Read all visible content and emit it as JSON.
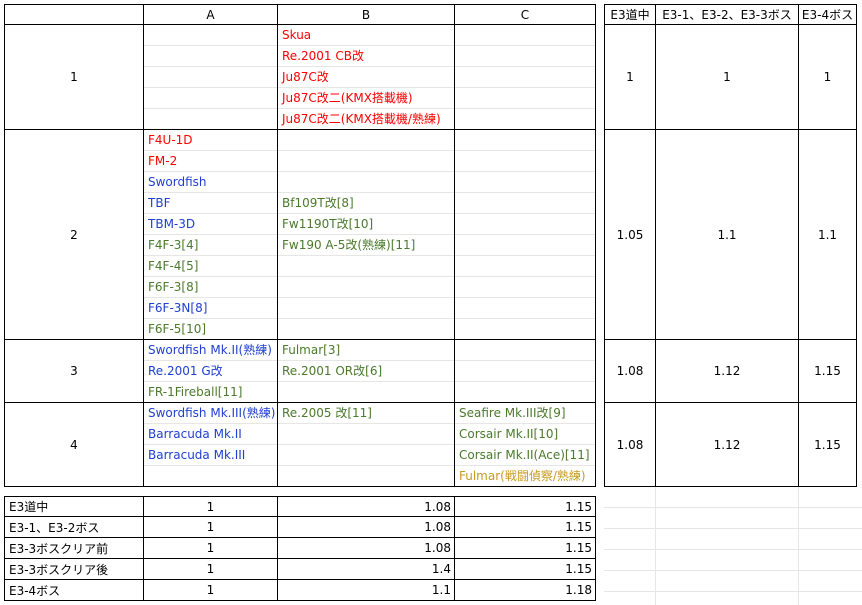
{
  "headers": {
    "corner": "",
    "col_a": "A",
    "col_b": "B",
    "col_c": "C",
    "r1": "E3道中",
    "r2": "E3-1、E3-2、E3-3ボス",
    "r3": "E3-4ボス"
  },
  "colors": {
    "red": "#ff0000",
    "blue": "#1f3fd0",
    "green": "#4a7a2b",
    "orange": "#c89a1e"
  },
  "groups": [
    {
      "label": "1",
      "a": [],
      "b": [
        {
          "text": "Skua",
          "color": "red"
        },
        {
          "text": "Re.2001 CB改",
          "color": "red"
        },
        {
          "text": "Ju87C改",
          "color": "red"
        },
        {
          "text": "Ju87C改二(KMX搭載機)",
          "color": "red"
        },
        {
          "text": "Ju87C改二(KMX搭載機/熟練)",
          "color": "red"
        }
      ],
      "c": [],
      "m1": "1",
      "m2": "1",
      "m3": "1"
    },
    {
      "label": "2",
      "a": [
        {
          "text": "F4U-1D",
          "color": "red"
        },
        {
          "text": "FM-2",
          "color": "red"
        },
        {
          "text": "Swordfish",
          "color": "blue"
        },
        {
          "text": "TBF",
          "color": "blue"
        },
        {
          "text": "TBM-3D",
          "color": "blue"
        },
        {
          "text": "F4F-3[4]",
          "color": "green"
        },
        {
          "text": "F4F-4[5]",
          "color": "green"
        },
        {
          "text": "F6F-3[8]",
          "color": "green"
        },
        {
          "text": "F6F-3N[8]",
          "color": "blue"
        },
        {
          "text": "F6F-5[10]",
          "color": "green"
        }
      ],
      "b": [
        {
          "text": "Bf109T改[8]",
          "color": "green"
        },
        {
          "text": "Fw1190T改[10]",
          "color": "green"
        },
        {
          "text": "Fw190 A-5改(熟練)[11]",
          "color": "green"
        }
      ],
      "c": [],
      "m1": "1.05",
      "m2": "1.1",
      "m3": "1.1"
    },
    {
      "label": "3",
      "a": [
        {
          "text": "Swordfish Mk.II(熟練)",
          "color": "blue"
        },
        {
          "text": "Re.2001 G改",
          "color": "blue"
        },
        {
          "text": "FR-1Fireball[11]",
          "color": "green"
        }
      ],
      "b": [
        {
          "text": "Fulmar[3]",
          "color": "green"
        },
        {
          "text": "Re.2001 OR改[6]",
          "color": "green"
        }
      ],
      "c": [],
      "m1": "1.08",
      "m2": "1.12",
      "m3": "1.15"
    },
    {
      "label": "4",
      "a": [
        {
          "text": "Swordfish Mk.III(熟練)",
          "color": "blue"
        },
        {
          "text": "Barracuda Mk.II",
          "color": "blue"
        },
        {
          "text": "Barracuda Mk.III",
          "color": "blue"
        }
      ],
      "b": [
        {
          "text": "Re.2005 改[11]",
          "color": "green"
        }
      ],
      "c": [
        {
          "text": "Seafire Mk.III改[9]",
          "color": "green"
        },
        {
          "text": "Corsair Mk.II[10]",
          "color": "green"
        },
        {
          "text": "Corsair Mk.II(Ace)[11]",
          "color": "green"
        },
        {
          "text": "Fulmar(戦闘偵察/熟練)",
          "color": "orange"
        }
      ],
      "m1": "1.08",
      "m2": "1.12",
      "m3": "1.15"
    }
  ],
  "summary": [
    {
      "label": "E3道中",
      "a": "1",
      "b": "1.08",
      "c": "1.15"
    },
    {
      "label": "E3-1、E3-2ボス",
      "a": "1",
      "b": "1.08",
      "c": "1.15"
    },
    {
      "label": "E3-3ボスクリア前",
      "a": "1",
      "b": "1.08",
      "c": "1.15"
    },
    {
      "label": "E3-3ボスクリア後",
      "a": "1",
      "b": "1.4",
      "c": "1.15"
    },
    {
      "label": "E3-4ボス",
      "a": "1",
      "b": "1.1",
      "c": "1.18"
    }
  ]
}
